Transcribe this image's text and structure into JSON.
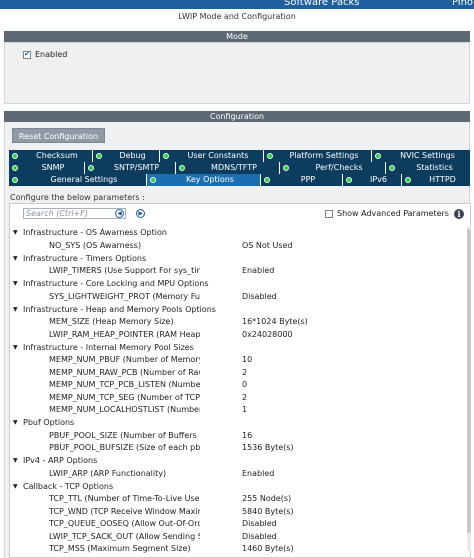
{
  "topbar": {
    "software_packs": "Software Packs",
    "pinout": "Pino"
  },
  "window_title": "LWIP Mode and Configuration",
  "mode": {
    "header": "Mode",
    "enabled_label": "Enabled",
    "enabled_checked": true
  },
  "configuration": {
    "header": "Configuration",
    "reset_button": "Reset Configuration",
    "tabs_row1": [
      "Checksum",
      "Debug",
      "User Constants",
      "Platform Settings",
      "NVIC Settings"
    ],
    "tabs_row2": [
      "SNMP",
      "SNTP/SMTP",
      "MDNS/TFTP",
      "Perf/Checks",
      "Statistics"
    ],
    "tabs_row3": [
      "General Settings",
      "Key Options",
      "PPP",
      "IPv6",
      "HTTPD"
    ],
    "active_tab": "Key Options",
    "configure_label": "Configure the below parameters :",
    "search_placeholder": "Search (Ctrl+F)",
    "show_advanced_label": "Show Advanced Parameters",
    "groups": [
      {
        "title": "Infrastructure - OS Awarness Option",
        "items": [
          {
            "name": "NO_SYS (OS Awarness)",
            "value": "OS Not Used"
          }
        ]
      },
      {
        "title": "Infrastructure - Timers Options",
        "items": [
          {
            "name": "LWIP_TIMERS (Use Support For sys_timeout)",
            "value": "Enabled"
          }
        ]
      },
      {
        "title": "Infrastructure - Core Locking and MPU Options",
        "items": [
          {
            "name": "SYS_LIGHTWEIGHT_PROT (Memory Functions...",
            "value": "Disabled"
          }
        ]
      },
      {
        "title": "Infrastructure - Heap and Memory Pools Options",
        "items": [
          {
            "name": "MEM_SIZE (Heap Memory Size)",
            "value": "16*1024 Byte(s)"
          },
          {
            "name": "LWIP_RAM_HEAP_POINTER (RAM Heap Point...",
            "value": "0x24028000"
          }
        ]
      },
      {
        "title": "Infrastructure - Internal Memory Pool Sizes",
        "items": [
          {
            "name": "MEMP_NUM_PBUF (Number of Memory Pool st...",
            "value": "10"
          },
          {
            "name": "MEMP_NUM_RAW_PCB (Number of Raw Proto...",
            "value": "2"
          },
          {
            "name": "MEMP_NUM_TCP_PCB_LISTEN (Number of Lis...",
            "value": "0"
          },
          {
            "name": "MEMP_NUM_TCP_SEG (Number of TCP Segm...",
            "value": "2"
          },
          {
            "name": "MEMP_NUM_LOCALHOSTLIST (Number of Hos...",
            "value": "1"
          }
        ]
      },
      {
        "title": "Pbuf Options",
        "items": [
          {
            "name": "PBUF_POOL_SIZE (Number of Buffers in the Pb...",
            "value": "16"
          },
          {
            "name": "PBUF_POOL_BUFSIZE (Size of each pbuf in th...",
            "value": "1536 Byte(s)"
          }
        ]
      },
      {
        "title": "IPv4 - ARP Options",
        "items": [
          {
            "name": "LWIP_ARP (ARP Functionality)",
            "value": "Enabled"
          }
        ]
      },
      {
        "title": "Callback - TCP Options",
        "items": [
          {
            "name": "TCP_TTL (Number of Time-To-Live Used by TCP ...",
            "value": "255 Node(s)"
          },
          {
            "name": "TCP_WND (TCP Receive Window Maximum Size)",
            "value": "5840 Byte(s)"
          },
          {
            "name": "TCP_QUEUE_OOSEQ (Allow Out-Of-Order Incom...",
            "value": "Disabled"
          },
          {
            "name": "LWIP_TCP_SACK_OUT (Allow Sending Selective...",
            "value": "Disabled"
          },
          {
            "name": "TCP_MSS (Maximum Segment Size)",
            "value": "1460 Byte(s)"
          }
        ]
      }
    ]
  },
  "colors": {
    "topbar": "#1f5f9e",
    "section_bar": "#5d6875",
    "tab_bg": "#0d3d5e",
    "tab_active": "#1b6fb0",
    "status_dot": "#2ecc40"
  }
}
